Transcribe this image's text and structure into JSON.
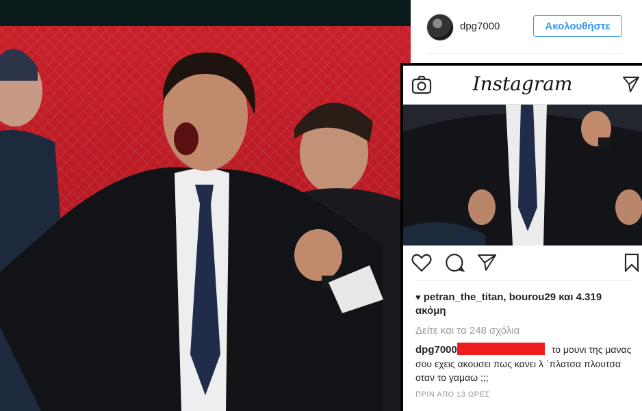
{
  "post": {
    "username": "dpg7000",
    "follow_label": "Ακολουθήστε"
  },
  "inset": {
    "app_logo": "Instagram",
    "likes_text": "petran_the_titan, bourou29 και 4.319 ακόμη",
    "view_comments": "Δείτε και τα 248 σχόλια",
    "caption_user": "dpg7000",
    "caption_text": "το μουνι της μανας σου εχεις ακουσει πως κανει λ ΄πλατσα πλουτσα οταν το γαμαω ;;;",
    "timestamp": "ΠΡΙΝ ΑΠΟ 13 ΩΡΕΣ"
  },
  "icons": {
    "camera": "camera-icon",
    "direct": "paper-plane-icon",
    "like": "heart-icon",
    "comment": "speech-bubble-icon",
    "share": "paper-plane-icon",
    "save": "bookmark-icon",
    "likes_heart": "♥"
  },
  "colors": {
    "accent": "#3897f0",
    "redaction": "#ee1c1c",
    "muted_text": "#999999",
    "text": "#262626"
  }
}
